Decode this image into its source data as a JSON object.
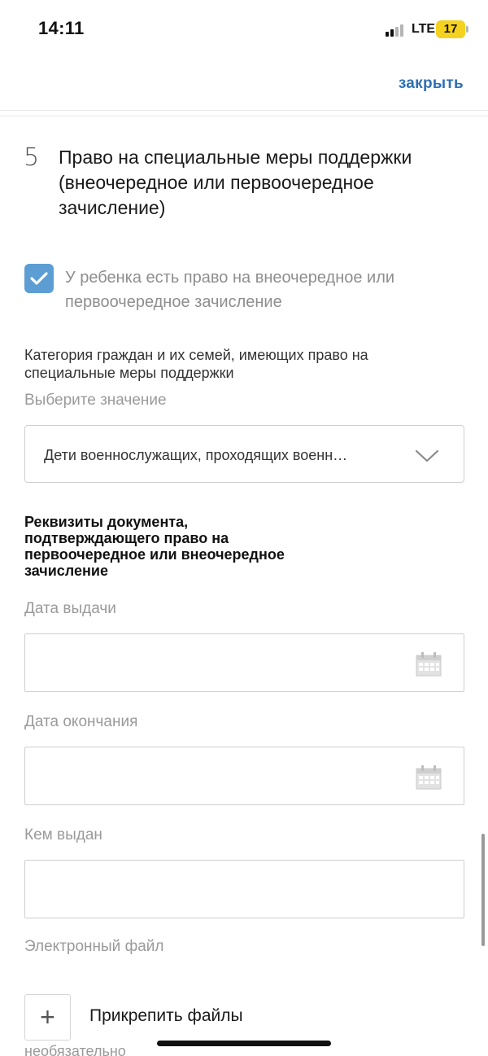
{
  "status_bar": {
    "time": "14:11",
    "network": "LTE",
    "battery": "17",
    "battery_color": "#f4d21f"
  },
  "top_bar": {
    "close_label": "закрыть",
    "accent_color": "#2f6fb5"
  },
  "section": {
    "number": "5",
    "title": "Право на специальные меры поддержки (внеочередное или первоочередное зачисление)"
  },
  "right_checkbox": {
    "checked": true,
    "label": "У ребенка есть право на внеочередное или первоочередное зачисление",
    "color": "#5c9ed3"
  },
  "category_field": {
    "label": "Категория граждан и их семей, имеющих право на специальные меры поддержки",
    "hint": "Выберите значение",
    "value": "Дети военнослужащих, проходящих военн…",
    "icon": "chevron-down-icon"
  },
  "document": {
    "title": "Реквизиты документа, подтверждающего право на первоочередное или внеочередное зачисление",
    "issue_date_label": "Дата выдачи",
    "issue_date_value": "",
    "end_date_label": "Дата окончания",
    "end_date_value": "",
    "issued_by_label": "Кем выдан",
    "issued_by_value": "",
    "calendar_icon": "calendar-icon"
  },
  "file": {
    "label": "Электронный файл",
    "attach_symbol": "+",
    "attach_label": "Прикрепить файлы",
    "optional_label": "необязательно"
  }
}
